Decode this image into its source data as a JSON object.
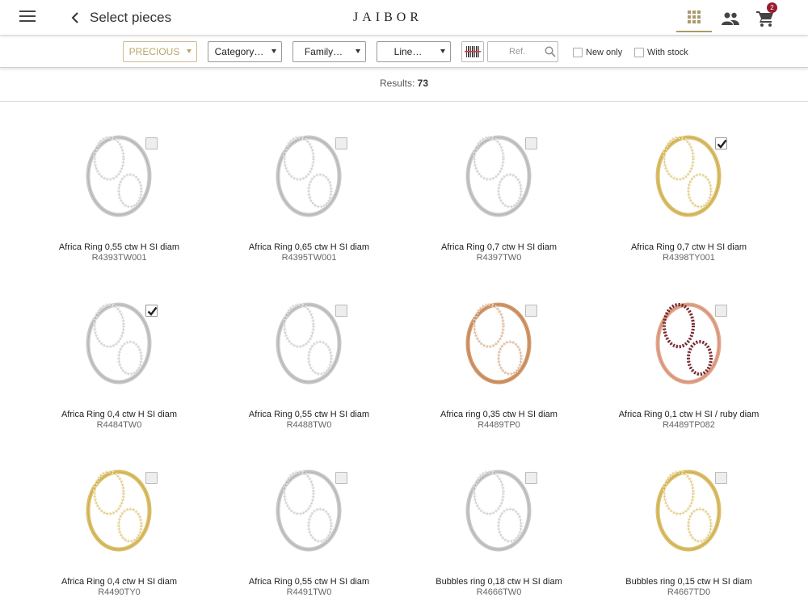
{
  "header": {
    "title": "Select pieces",
    "brand": "JAIBOR",
    "cart_count": "2",
    "icons": [
      "menu-icon",
      "back-icon",
      "grid-view-icon",
      "users-icon",
      "cart-icon"
    ]
  },
  "filters": {
    "collection": "PRECIOUS",
    "category": "Category…",
    "family": "Family…",
    "line": "Line…",
    "ref_placeholder": "Ref.",
    "new_only": "New only",
    "with_stock": "With stock"
  },
  "results": {
    "label": "Results:",
    "count": "73"
  },
  "colors": {
    "accent": "#b8a76a",
    "badge": "#9b1b30"
  },
  "products": [
    {
      "name": "Africa Ring 0,55 ctw H SI diam",
      "ref": "R4393TW001",
      "checked": false,
      "metal": "white"
    },
    {
      "name": "Africa Ring 0,65 ctw H SI diam",
      "ref": "R4395TW001",
      "checked": false,
      "metal": "white"
    },
    {
      "name": "Africa Ring 0,7 ctw H SI diam",
      "ref": "R4397TW0",
      "checked": false,
      "metal": "white"
    },
    {
      "name": "Africa Ring 0,7 ctw H SI diam",
      "ref": "R4398TY001",
      "checked": true,
      "metal": "yellow"
    },
    {
      "name": "Africa Ring 0,4 ctw H SI diam",
      "ref": "R4484TW0",
      "checked": true,
      "metal": "white"
    },
    {
      "name": "Africa Ring 0,55 ctw H SI diam",
      "ref": "R4488TW0",
      "checked": false,
      "metal": "white"
    },
    {
      "name": "Africa ring 0,35 ctw H SI diam",
      "ref": "R4489TP0",
      "checked": false,
      "metal": "rose"
    },
    {
      "name": "Africa Ring 0,1 ctw H SI / ruby diam",
      "ref": "R4489TP082",
      "checked": false,
      "metal": "rose-ruby"
    },
    {
      "name": "Africa Ring 0,4 ctw H SI diam",
      "ref": "R4490TY0",
      "checked": false,
      "metal": "yellow"
    },
    {
      "name": "Africa Ring 0,55 ctw H SI diam",
      "ref": "R4491TW0",
      "checked": false,
      "metal": "white"
    },
    {
      "name": "Bubbles ring 0,18 ctw H SI diam",
      "ref": "R4666TW0",
      "checked": false,
      "metal": "white"
    },
    {
      "name": "Bubbles ring 0,15 ctw H SI diam",
      "ref": "R4667TD0",
      "checked": false,
      "metal": "yellow"
    }
  ]
}
